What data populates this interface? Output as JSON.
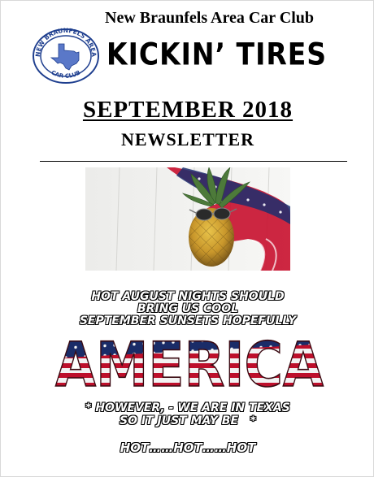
{
  "header": {
    "club_name": "New Braunfels Area Car Club",
    "newsletter_name": "KICKIN’ TIRES"
  },
  "logo": {
    "ring_text_top": "NEW BRAUNFELS AREA",
    "ring_text_bottom": "CAR CLUB",
    "ring_color": "#1f3f8f",
    "state_color": "#5a78c8"
  },
  "issue": {
    "month_year": "SEPTEMBER 2018",
    "label": "NEWSLETTER"
  },
  "photo": {
    "subject": "pineapple-with-sunglasses-and-flag-bandana"
  },
  "message": {
    "line1": "HOT AUGUST NIGHTS SHOULD",
    "line2": "BRING US COOL",
    "line3": "SEPTEMBER SUNSETS HOPEFULLY",
    "america": "AMERICA",
    "however1": "* HOWEVER, - WE ARE IN TEXAS",
    "however2": "SO IT JUST MAY BE   *",
    "hot": "HOT……HOT……HOT"
  },
  "colors": {
    "flag_red": "#c8102e",
    "flag_blue": "#1c2f6e",
    "flag_white": "#ffffff"
  }
}
